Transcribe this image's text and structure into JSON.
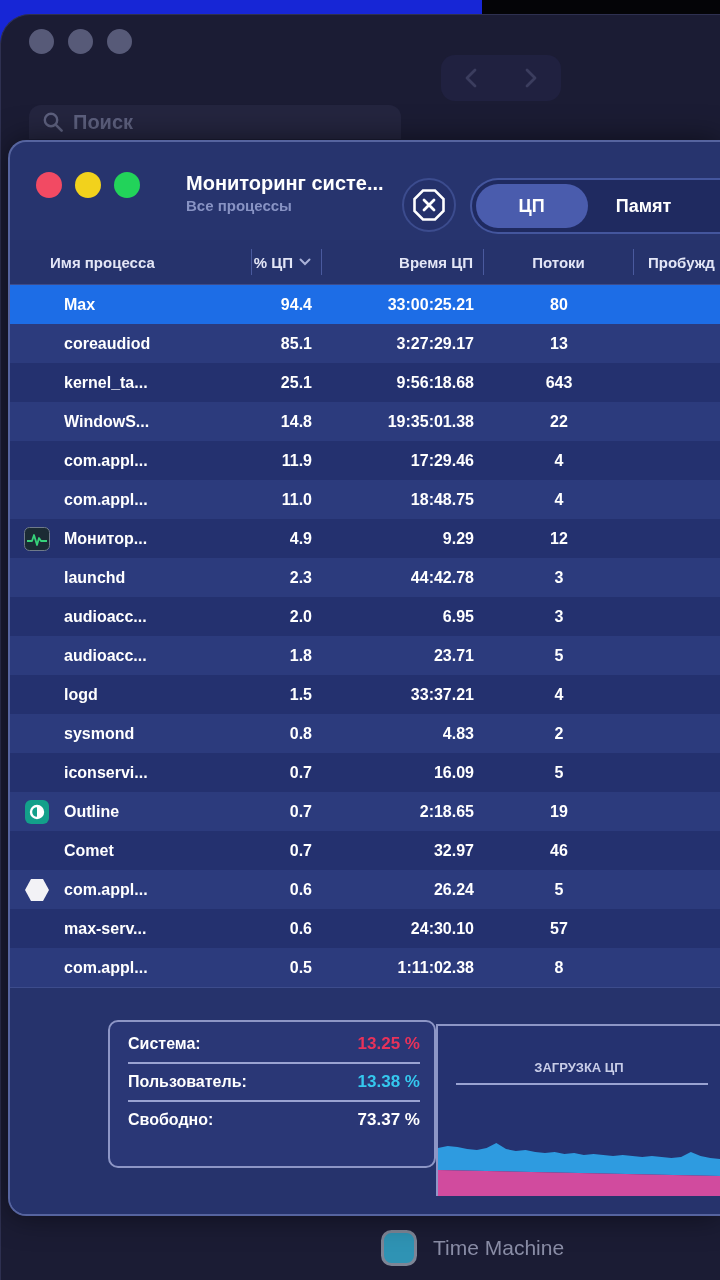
{
  "background_window": {
    "active": false,
    "search": {
      "placeholder": "Поиск"
    },
    "sidebar_items": [
      {
        "label": "Time Machine"
      }
    ]
  },
  "window": {
    "active": true,
    "title": "Мониторинг систе...",
    "subtitle": "Все процессы",
    "tabs": [
      {
        "label": "ЦП",
        "selected": true
      },
      {
        "label": "Памят",
        "selected": false
      }
    ]
  },
  "table": {
    "columns": [
      {
        "label": "Имя процесса",
        "sorted": false
      },
      {
        "label": "% ЦП",
        "sorted": true
      },
      {
        "label": "Время ЦП",
        "sorted": false
      },
      {
        "label": "Потоки",
        "sorted": false
      },
      {
        "label": "Пробужд",
        "sorted": false
      }
    ],
    "rows": [
      {
        "kind": "plain",
        "name": "Max",
        "cpu": "94.4",
        "time": "33:00:25.21",
        "threads": "80",
        "selected": true
      },
      {
        "kind": "plain",
        "name": "coreaudiod",
        "cpu": "85.1",
        "time": "3:27:29.17",
        "threads": "13",
        "selected": false
      },
      {
        "kind": "plain",
        "name": "kernel_ta...",
        "cpu": "25.1",
        "time": "9:56:18.68",
        "threads": "643",
        "selected": false
      },
      {
        "kind": "plain",
        "name": "WindowS...",
        "cpu": "14.8",
        "time": "19:35:01.38",
        "threads": "22",
        "selected": false
      },
      {
        "kind": "plain",
        "name": "com.appl...",
        "cpu": "11.9",
        "time": "17:29.46",
        "threads": "4",
        "selected": false
      },
      {
        "kind": "plain",
        "name": "com.appl...",
        "cpu": "11.0",
        "time": "18:48.75",
        "threads": "4",
        "selected": false
      },
      {
        "kind": "pulse",
        "name": "Монитор...",
        "cpu": "4.9",
        "time": "9.29",
        "threads": "12",
        "selected": false
      },
      {
        "kind": "plain",
        "name": "launchd",
        "cpu": "2.3",
        "time": "44:42.78",
        "threads": "3",
        "selected": false
      },
      {
        "kind": "plain",
        "name": "audioacc...",
        "cpu": "2.0",
        "time": "6.95",
        "threads": "3",
        "selected": false
      },
      {
        "kind": "plain",
        "name": "audioacc...",
        "cpu": "1.8",
        "time": "23.71",
        "threads": "5",
        "selected": false
      },
      {
        "kind": "plain",
        "name": "logd",
        "cpu": "1.5",
        "time": "33:37.21",
        "threads": "4",
        "selected": false
      },
      {
        "kind": "plain",
        "name": "sysmond",
        "cpu": "0.8",
        "time": "4.83",
        "threads": "2",
        "selected": false
      },
      {
        "kind": "plain",
        "name": "iconservi...",
        "cpu": "0.7",
        "time": "16.09",
        "threads": "5",
        "selected": false
      },
      {
        "kind": "half-circle",
        "name": "Outline",
        "cpu": "0.7",
        "time": "2:18.65",
        "threads": "19",
        "selected": false
      },
      {
        "kind": "plain",
        "name": "Comet",
        "cpu": "0.7",
        "time": "32.97",
        "threads": "46",
        "selected": false
      },
      {
        "kind": "hexagon",
        "name": "com.appl...",
        "cpu": "0.6",
        "time": "26.24",
        "threads": "5",
        "selected": false
      },
      {
        "kind": "plain",
        "name": "max-serv...",
        "cpu": "0.6",
        "time": "24:30.10",
        "threads": "57",
        "selected": false
      },
      {
        "kind": "plain",
        "name": "com.appl...",
        "cpu": "0.5",
        "time": "1:11:02.38",
        "threads": "8",
        "selected": false
      }
    ]
  },
  "summary": {
    "items": [
      {
        "label": "Система:",
        "value": "13.25 %",
        "color": "#e8325a"
      },
      {
        "label": "Пользователь:",
        "value": "13.38 %",
        "color": "#35c8ee"
      },
      {
        "label": "Свободно:",
        "value": "73.37 %",
        "color": "#ffffff"
      }
    ]
  },
  "load_chart": {
    "title": "ЗАГРУЗКА ЦП"
  }
}
